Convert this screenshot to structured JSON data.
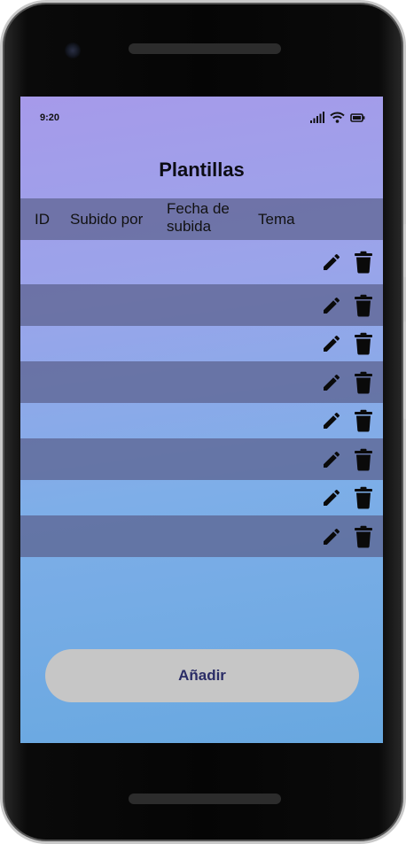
{
  "status_bar": {
    "time": "9:20"
  },
  "page": {
    "title": "Plantillas"
  },
  "table": {
    "columns": [
      {
        "key": "id",
        "label": "ID"
      },
      {
        "key": "subido_por",
        "label": "Subido por"
      },
      {
        "key": "fecha_subida",
        "label": "Fecha de subida"
      },
      {
        "key": "tema",
        "label": "Tema"
      }
    ],
    "rows": [
      {
        "id": "",
        "subido_por": "",
        "fecha_subida": "",
        "tema": ""
      },
      {
        "id": "",
        "subido_por": "",
        "fecha_subida": "",
        "tema": ""
      },
      {
        "id": "",
        "subido_por": "",
        "fecha_subida": "",
        "tema": ""
      },
      {
        "id": "",
        "subido_por": "",
        "fecha_subida": "",
        "tema": ""
      },
      {
        "id": "",
        "subido_por": "",
        "fecha_subida": "",
        "tema": ""
      },
      {
        "id": "",
        "subido_por": "",
        "fecha_subida": "",
        "tema": ""
      },
      {
        "id": "",
        "subido_por": "",
        "fecha_subida": "",
        "tema": ""
      },
      {
        "id": "",
        "subido_por": "",
        "fecha_subida": "",
        "tema": ""
      }
    ],
    "row_actions": [
      "pencil-icon",
      "trash-icon"
    ]
  },
  "add_button": {
    "label": "Añadir"
  },
  "colors": {
    "button_bg": "#c6c6c6",
    "button_text": "#2a2c66",
    "header_row": "#5f6491",
    "screen_gradient_top": "#a69aea",
    "screen_gradient_bottom": "#68a8e0"
  }
}
